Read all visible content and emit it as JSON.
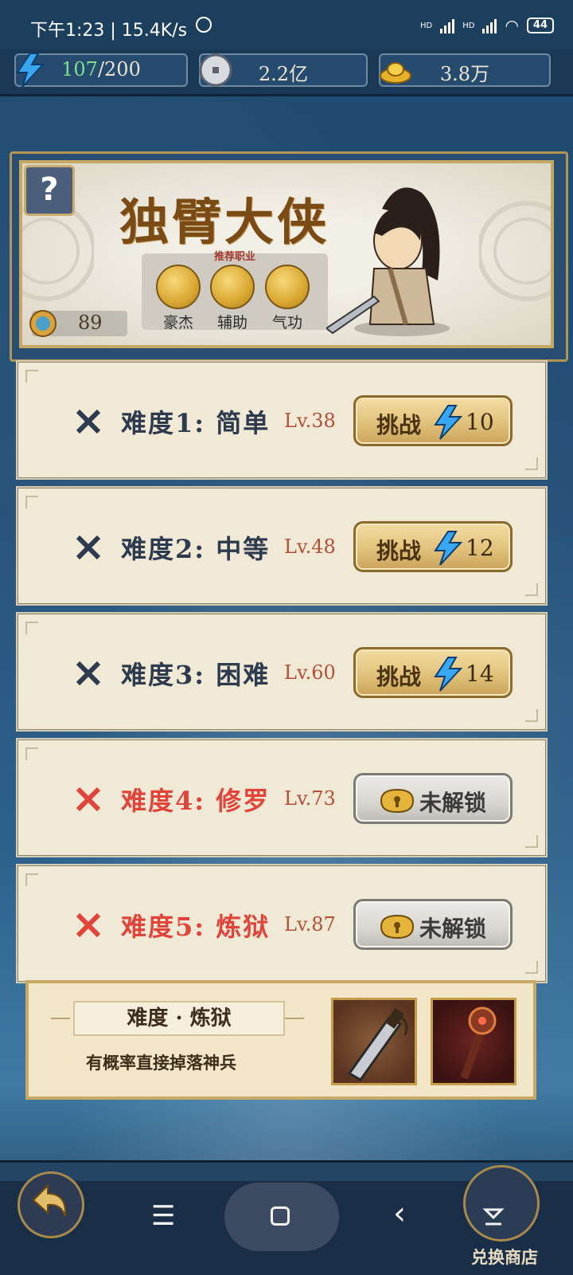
{
  "status_bar": {
    "time_net": "下午1:23 | 15.4K/s",
    "battery": "44",
    "hd1": "HD",
    "hd2": "HD"
  },
  "resources": {
    "energy_current": "107",
    "energy_max": "/200",
    "coins": "2.2亿",
    "gold": "3.8万"
  },
  "banner": {
    "help": "?",
    "boss_name": "独臂大侠",
    "recommended_label": "推荐职业",
    "jobs": [
      "豪杰",
      "辅助",
      "气功"
    ],
    "level": "89"
  },
  "difficulties": [
    {
      "title": "难度1: 简单",
      "level": "Lv.38",
      "button": "挑战",
      "cost": "10",
      "locked": false
    },
    {
      "title": "难度2: 中等",
      "level": "Lv.48",
      "button": "挑战",
      "cost": "12",
      "locked": false
    },
    {
      "title": "难度3: 困难",
      "level": "Lv.60",
      "button": "挑战",
      "cost": "14",
      "locked": false
    },
    {
      "title": "难度4: 修罗",
      "level": "Lv.73",
      "button": "未解锁",
      "locked": true
    },
    {
      "title": "难度5: 炼狱",
      "level": "Lv.87",
      "button": "未解锁",
      "locked": true
    }
  ],
  "reward": {
    "title": "难度 · 炼狱",
    "description": "有概率直接掉落神兵"
  },
  "bottom": {
    "shop_label": "兑换商店"
  },
  "colors": {
    "energy_green": "#7ee08f",
    "danger_red": "#e0443b",
    "level_red": "#b0503a",
    "gold_button": "#e1c27b"
  }
}
